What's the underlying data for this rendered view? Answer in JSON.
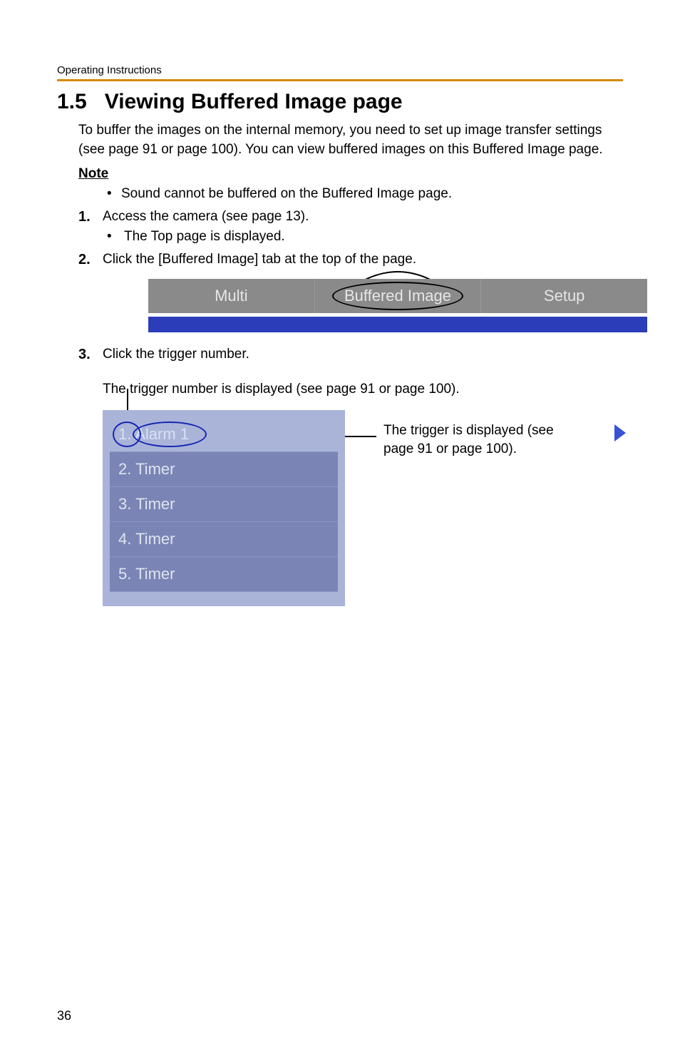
{
  "header": "Operating Instructions",
  "section_number": "1.5",
  "section_title": "Viewing Buffered Image page",
  "intro": "To buffer the images on the internal memory, you need to set up image transfer settings (see page 91 or page 100). You can view buffered images on this Buffered Image page.",
  "note_label": "Note",
  "note_bullet": "Sound cannot be buffered on the Buffered Image page.",
  "steps": [
    {
      "num": "1.",
      "text": "Access the camera (see page 13).",
      "sub": "The Top page is displayed."
    },
    {
      "num": "2.",
      "text": "Click the [Buffered Image] tab at the top of the page."
    },
    {
      "num": "3.",
      "text": "Click the trigger number."
    }
  ],
  "tabs": {
    "left": "Multi",
    "center": "Buffered Image",
    "right": "Setup"
  },
  "after_step3": "The trigger number is displayed (see page 91 or page 100).",
  "trigger_items": [
    "1. Alarm 1",
    "2. Timer",
    "3. Timer",
    "4. Timer",
    "5. Timer"
  ],
  "callout": "The trigger is displayed (see page 91 or page 100).",
  "page_number": "36"
}
